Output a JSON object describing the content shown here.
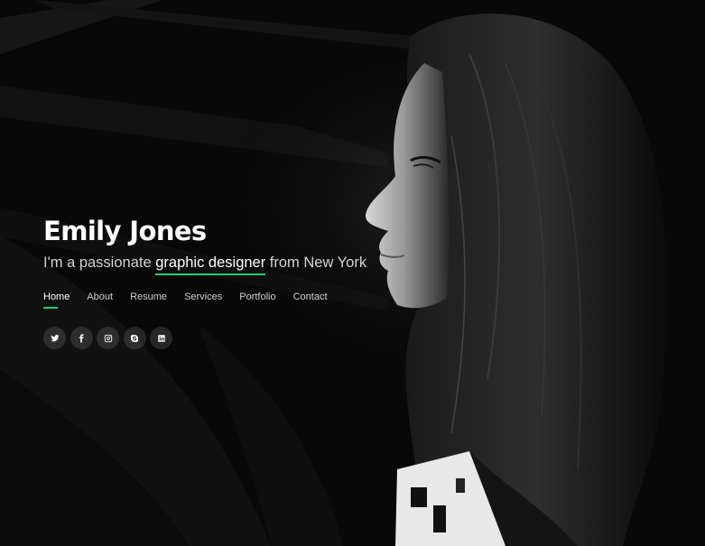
{
  "hero": {
    "name": "Emily Jones",
    "tagline_prefix": "I'm a passionate ",
    "tagline_role": "graphic designer",
    "tagline_suffix": " from New York"
  },
  "nav": {
    "items": [
      {
        "label": "Home",
        "active": true
      },
      {
        "label": "About",
        "active": false
      },
      {
        "label": "Resume",
        "active": false
      },
      {
        "label": "Services",
        "active": false
      },
      {
        "label": "Portfolio",
        "active": false
      },
      {
        "label": "Contact",
        "active": false
      }
    ]
  },
  "social": {
    "links": [
      {
        "icon": "twitter-icon"
      },
      {
        "icon": "facebook-icon"
      },
      {
        "icon": "instagram-icon"
      },
      {
        "icon": "skype-icon"
      },
      {
        "icon": "linkedin-icon"
      }
    ]
  },
  "colors": {
    "accent": "#18d26e",
    "background": "#070707",
    "text": "#ffffff"
  }
}
